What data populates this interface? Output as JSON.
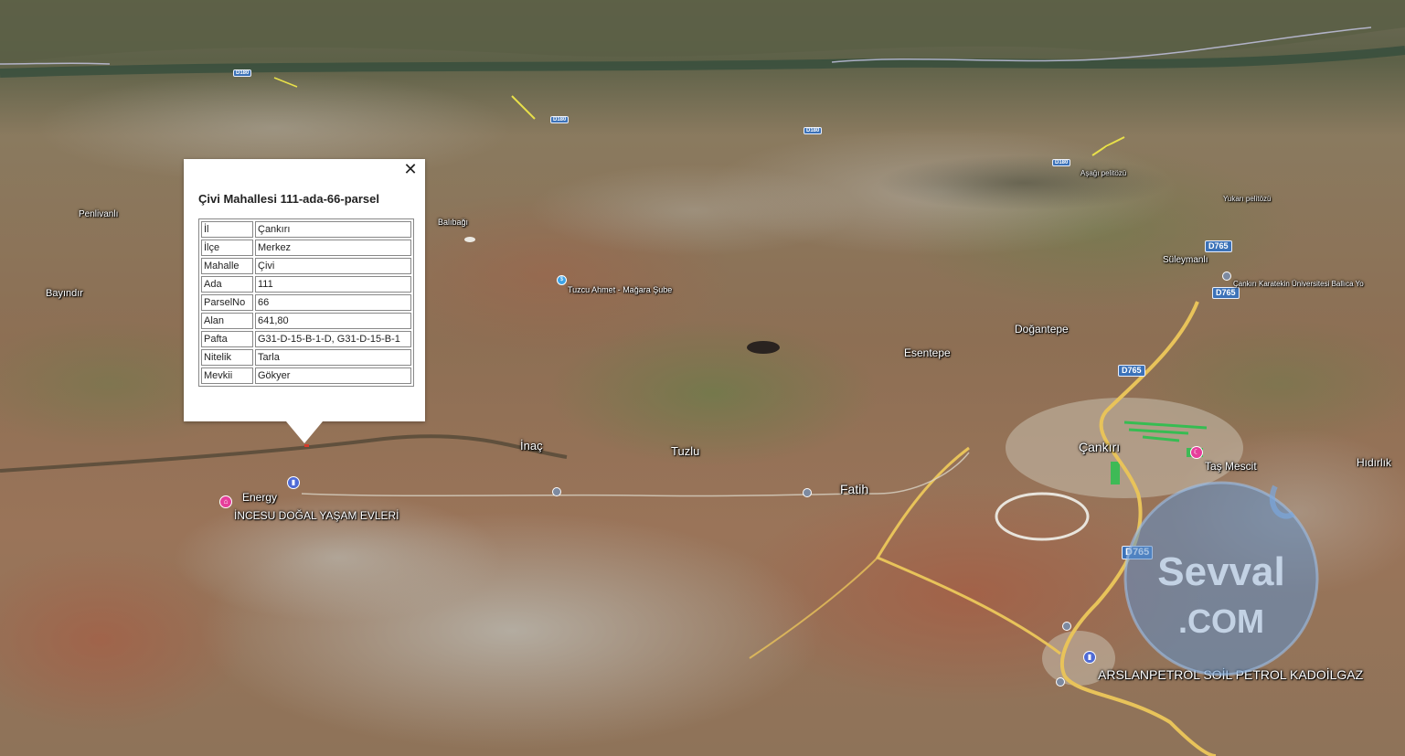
{
  "popup": {
    "title": "Çivi Mahallesi 111-ada-66-parsel",
    "close_symbol": "✕",
    "rows": [
      {
        "key": "İl",
        "value": "Çankırı"
      },
      {
        "key": "İlçe",
        "value": "Merkez"
      },
      {
        "key": "Mahalle",
        "value": "Çivi"
      },
      {
        "key": "Ada",
        "value": "111"
      },
      {
        "key": "ParselNo",
        "value": "66"
      },
      {
        "key": "Alan",
        "value": "641,80"
      },
      {
        "key": "Pafta",
        "value": "G31-D-15-B-1-D, G31-D-15-B-1"
      },
      {
        "key": "Nitelik",
        "value": "Tarla"
      },
      {
        "key": "Mevkii",
        "value": "Gökyer"
      }
    ]
  },
  "map_labels": {
    "cankiri": "Çankırı",
    "fatih": "Fatih",
    "tuzlu": "Tuzlu",
    "inac": "İnaç",
    "esentepe": "Esentepe",
    "dogantepe": "Doğantepe",
    "suleymanli": "Süleymanlı",
    "tas_mescit": "Taş Mescit",
    "hidirlik": "Hıdırlık",
    "bayindir": "Bayındır",
    "penlivanli": "Penlivanlı",
    "balibagi": "Balıbağı",
    "tuzcu_ahmet": "Tuzcu Ahmet - Mağara Şube",
    "energy": "Energy",
    "incesu": "İNCESU DOĞAL YAŞAM EVLERİ",
    "arslanpetrol": "ARSLANPETROL SOİL PETROL KADOİLGAZ",
    "university": "Çankırı Karatekin Üniversitesi Ballıca Yo",
    "asag_pelitozu": "Aşağı pelitözü",
    "yukari_pelitozu": "Yukarı pelitözü"
  },
  "road_shields": {
    "d765_a": "D765",
    "d765_b": "D765",
    "d765_c": "D765",
    "d765_d": "D765",
    "d180_a": "D180",
    "d180_b": "D180",
    "d180_c": "D180",
    "d180_d": "D180"
  },
  "watermark": {
    "text_top": "Sevval",
    "text_bottom": ".COM"
  },
  "colors": {
    "road_main": "#e8c35a",
    "water_blue": "#3c72b8",
    "park_green": "#22c24a",
    "popup_bg": "#ffffff"
  }
}
